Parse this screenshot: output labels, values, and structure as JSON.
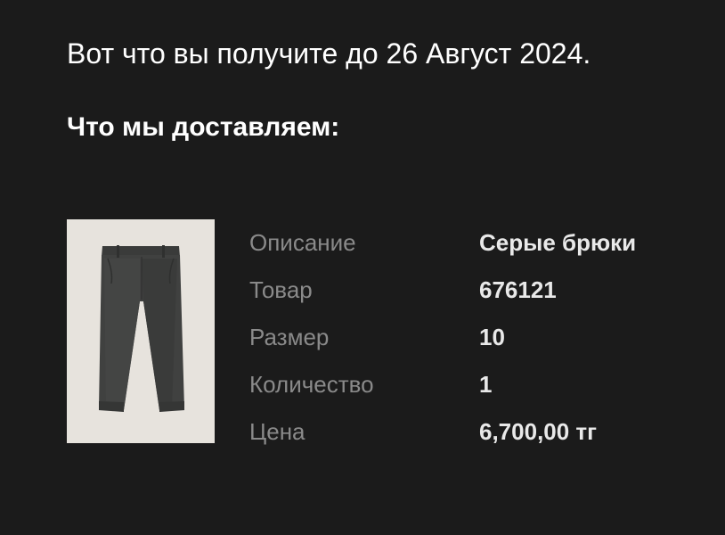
{
  "headline": "Вот что вы получите до 26 Август 2024.",
  "section_title": "Что мы доставляем:",
  "product": {
    "image_icon": "gray-trousers-image",
    "details": [
      {
        "label": "Описание",
        "value": "Серые брюки"
      },
      {
        "label": "Товар",
        "value": "676121"
      },
      {
        "label": "Размер",
        "value": "10"
      },
      {
        "label": "Количество",
        "value": "1"
      },
      {
        "label": "Цена",
        "value": "6,700,00 тг"
      }
    ]
  },
  "colors": {
    "background": "#1b1b1b",
    "label": "#8a8a8a",
    "value": "#e9e9e9",
    "image_background": "#e7e3dd"
  }
}
